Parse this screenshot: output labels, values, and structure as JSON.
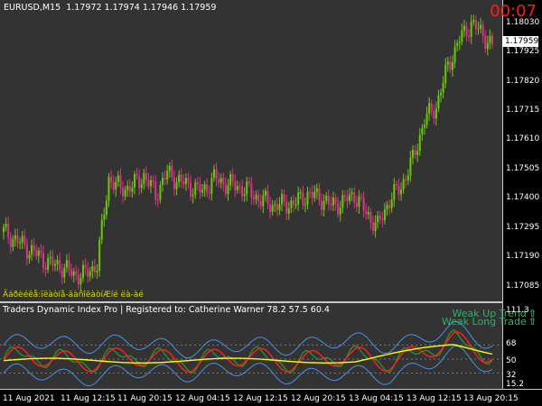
{
  "header": {
    "symbol_tf": "EURUSD,M15",
    "ohlc": "1.17972 1.17974 1.17946 1.17959"
  },
  "timer": "00:07",
  "bottom_label": "Ãáðèéêå:ïëàòíå-äàñîëàòíÆíé ëà-àé",
  "indicator": {
    "title": "Traders Dynamic Index Pro | Registered to: Catherine Warner 78.2 57.5 60.4",
    "trend_up": "Weak Up Trend",
    "trend_long": "Weak Long Trade",
    "ticks": [
      "111.3",
      "68",
      "50",
      "32",
      "15.2"
    ]
  },
  "price_axis": {
    "current": "1.17959",
    "ticks": [
      "1.18030",
      "1.17925",
      "1.17820",
      "1.17715",
      "1.17610",
      "1.17505",
      "1.17400",
      "1.17295",
      "1.17190",
      "1.17085"
    ]
  },
  "time_axis": [
    "11 Aug 2021",
    "11 Aug 12:15",
    "11 Aug 20:15",
    "12 Aug 04:15",
    "12 Aug 12:15",
    "12 Aug 20:15",
    "13 Aug 04:15",
    "13 Aug 12:15",
    "13 Aug 20:15"
  ],
  "colors": {
    "bg": "#333333",
    "bull": "#66cc00",
    "bear": "#e0308c",
    "rsi": "#2a9a2a",
    "signal": "#ff2020",
    "bands": "#4a90e2",
    "midline": "#ffff00",
    "timer": "#ff1a1a",
    "trend": "#2db36b"
  },
  "chart_data": {
    "type": "candlestick",
    "symbol": "EURUSD",
    "timeframe": "M15",
    "ylim": [
      1.1704,
      1.181
    ],
    "close_path": [
      1.1728,
      1.1725,
      1.1722,
      1.1719,
      1.1716,
      1.1715,
      1.1712,
      1.1712,
      1.1716,
      1.1748,
      1.1744,
      1.1745,
      1.1749,
      1.1742,
      1.175,
      1.1747,
      1.1745,
      1.1743,
      1.1748,
      1.1746,
      1.1745,
      1.1743,
      1.174,
      1.1738,
      1.1738,
      1.1739,
      1.1742,
      1.1741,
      1.1738,
      1.1739,
      1.1742,
      1.1735,
      1.173,
      1.174,
      1.1745,
      1.1755,
      1.177,
      1.1775,
      1.179,
      1.18,
      1.1806,
      1.1802,
      1.1796
    ]
  }
}
